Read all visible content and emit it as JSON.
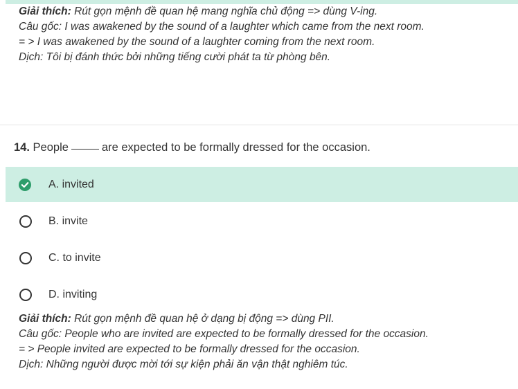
{
  "previous_explanation": {
    "label": "Giải thích:",
    "text": "Rút gọn mệnh đề quan hệ mang nghĩa chủ động => dùng V-ing.",
    "original": "Câu gốc: I was awakened by the sound of a laughter which came from the next room.",
    "rewritten": "= > I was awakened by the sound of a laughter coming from the next room.",
    "translation": "Dịch: Tôi bị đánh thức bởi những tiếng cười phát ta từ phòng bên."
  },
  "question": {
    "number": "14.",
    "text_before": "People",
    "text_after": "are expected to be formally dressed for the occasion."
  },
  "options": [
    {
      "label": "A. invited",
      "correct": true
    },
    {
      "label": "B. invite",
      "correct": false
    },
    {
      "label": "C. to invite",
      "correct": false
    },
    {
      "label": "D. inviting",
      "correct": false
    }
  ],
  "explanation": {
    "label": "Giải thích:",
    "text": "Rút gọn mệnh đề quan hệ ở dạng bị động => dùng PII.",
    "original": "Câu gốc: People who are invited are expected to be formally dressed for the occasion.",
    "rewritten": "= > People invited are expected to be formally dressed for the occasion.",
    "translation": "Dịch: Những người được mời tới sự kiện phải ăn vận thật nghiêm túc."
  },
  "colors": {
    "correct_background": "#cdeee3",
    "correct_icon": "#2e9d6b",
    "text": "#333333"
  }
}
